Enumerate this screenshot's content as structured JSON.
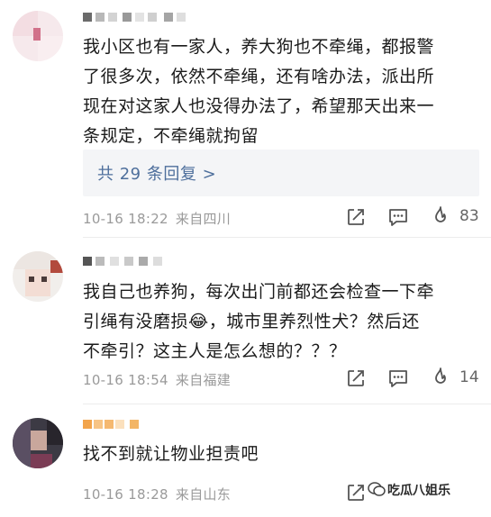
{
  "comments": [
    {
      "text": "我小区也有一家人，养大狗也不牵绳，都报警\n了很多次，依然不牵绳，还有啥办法，派出所\n现在对这家人也没得办法了，希望那天出来一\n条规定，不牵绳就拘留",
      "reply_label": "共 29 条回复 >",
      "time": "10-16 18:22",
      "location": "来自四川",
      "likes": "83"
    },
    {
      "text": "我自己也养狗，每次出门前都还会检查一下牵\n引绳有没磨损😂，城市里养烈性犬？然后还\n不牵引？这主人是怎么想的？？？",
      "time": "10-16 18:54",
      "location": "来自福建",
      "likes": "14"
    },
    {
      "text": "找不到就让物业担责吧",
      "time": "10-16 18:28",
      "location": "来自山东"
    }
  ],
  "watermark": "吃瓜八姐乐",
  "icons": [
    "share-icon",
    "comment-icon",
    "like-flame-icon"
  ]
}
